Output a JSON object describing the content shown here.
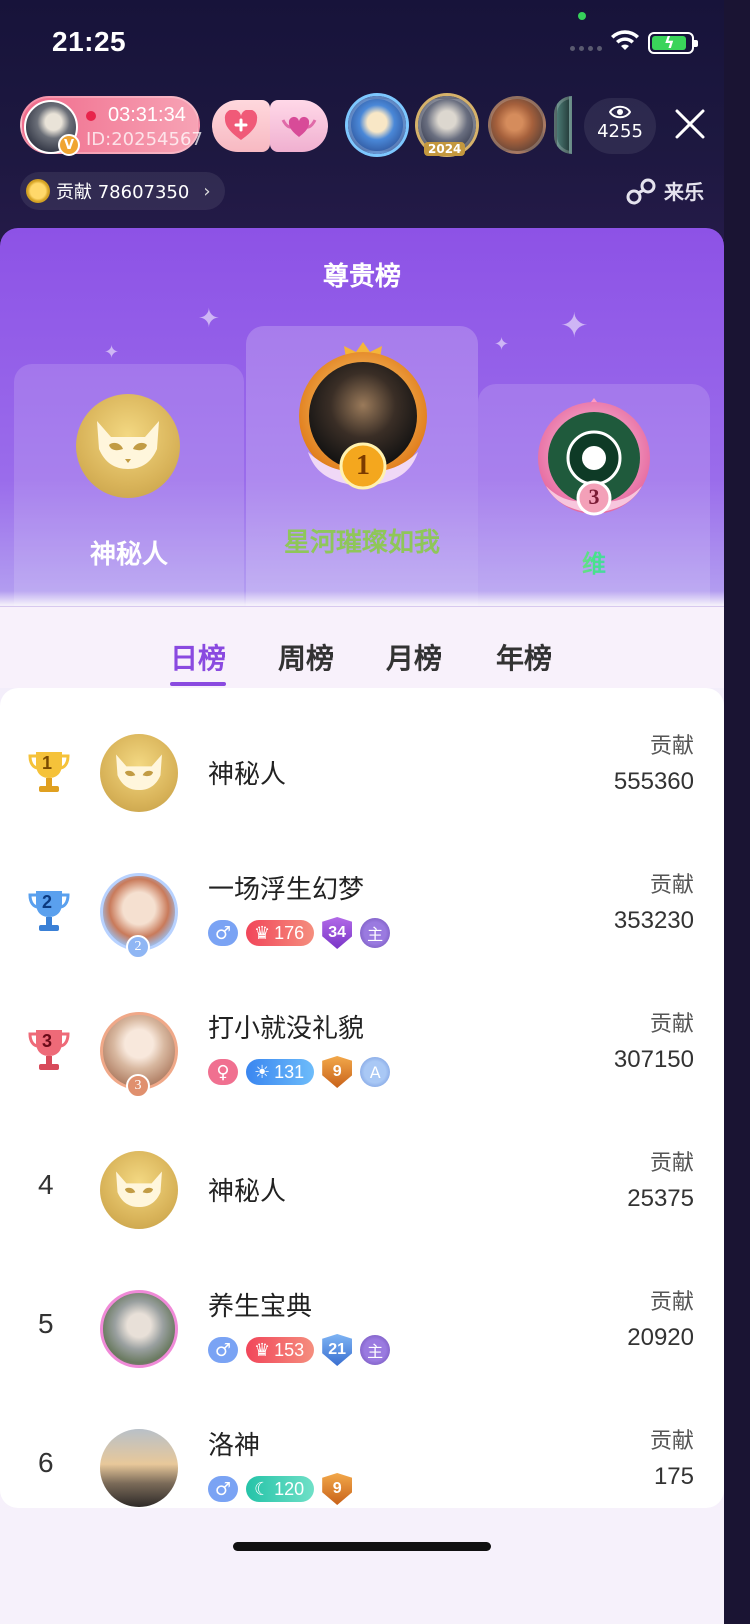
{
  "status_bar": {
    "time": "21:25"
  },
  "host": {
    "timer": "03:31:34",
    "id": "ID:20254567",
    "badge": "V"
  },
  "viewers": {
    "badge_year": "2024",
    "count": "4255"
  },
  "contribution": {
    "label": "贡献 78607350",
    "chevron": "›"
  },
  "brand": {
    "name": "来乐"
  },
  "panel": {
    "title": "尊贵榜"
  },
  "podium": {
    "first": {
      "name": "星河璀璨如我",
      "rank": "1"
    },
    "second": {
      "name": "神秘人"
    },
    "third": {
      "name": "维",
      "rank": "3"
    }
  },
  "tabs": [
    {
      "label": "日榜",
      "active": true
    },
    {
      "label": "周榜",
      "active": false
    },
    {
      "label": "月榜",
      "active": false
    },
    {
      "label": "年榜",
      "active": false
    }
  ],
  "contrib_label": "贡献",
  "rows": [
    {
      "rank": "1",
      "name": "神秘人",
      "value": "555360"
    },
    {
      "rank": "2",
      "name": "一场浮生幻梦",
      "gender": "♂",
      "level": "176",
      "shield": "34",
      "guard": "主",
      "value": "353230",
      "avatar_badge": "2"
    },
    {
      "rank": "3",
      "name": "打小就没礼貌",
      "gender": "♀",
      "level": "131",
      "shield": "9",
      "guard": "A",
      "value": "307150",
      "avatar_badge": "3"
    },
    {
      "rank": "4",
      "name": "神秘人",
      "value": "25375"
    },
    {
      "rank": "5",
      "name": "养生宝典",
      "gender": "♂",
      "level": "153",
      "shield": "21",
      "guard": "主",
      "value": "20920"
    },
    {
      "rank": "6",
      "name": "洛神",
      "gender": "♂",
      "level": "120",
      "shield": "9",
      "value": "175"
    }
  ],
  "colors": {
    "accent": "#8a4ae0",
    "sheet_top": "#8d52e6"
  }
}
